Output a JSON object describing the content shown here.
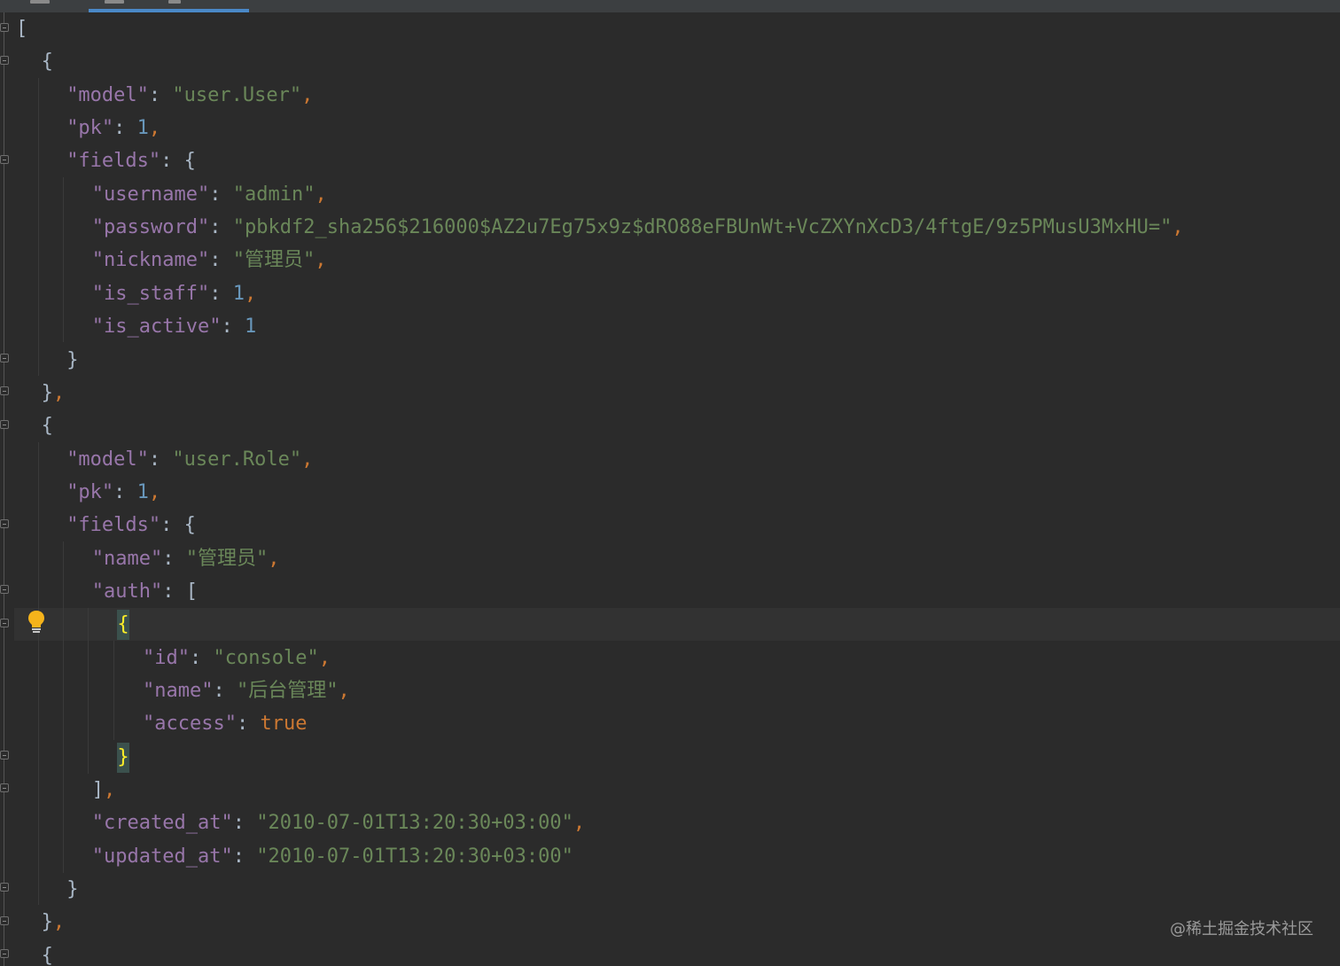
{
  "colors": {
    "background": "#2b2b2b",
    "key": "#9876aa",
    "string": "#6a8759",
    "number": "#6897bb",
    "keyword": "#cc7832",
    "brace_highlight": "#ffef28",
    "tab_indicator": "#4a88c7"
  },
  "icons": {
    "intention": "lightbulb-icon",
    "fold": "fold-marker-icon"
  },
  "watermark": "@稀土掘金技术社区",
  "lines": [
    {
      "indent": 0,
      "tokens": [
        {
          "t": "[",
          "c": "punct"
        }
      ]
    },
    {
      "indent": 1,
      "tokens": [
        {
          "t": "{",
          "c": "punct"
        }
      ]
    },
    {
      "indent": 2,
      "tokens": [
        {
          "t": "\"model\"",
          "c": "key"
        },
        {
          "t": ": ",
          "c": "punct"
        },
        {
          "t": "\"user.User\"",
          "c": "str"
        },
        {
          "t": ",",
          "c": "comma"
        }
      ]
    },
    {
      "indent": 2,
      "tokens": [
        {
          "t": "\"pk\"",
          "c": "key"
        },
        {
          "t": ": ",
          "c": "punct"
        },
        {
          "t": "1",
          "c": "num"
        },
        {
          "t": ",",
          "c": "comma"
        }
      ]
    },
    {
      "indent": 2,
      "tokens": [
        {
          "t": "\"fields\"",
          "c": "key"
        },
        {
          "t": ": ",
          "c": "punct"
        },
        {
          "t": "{",
          "c": "punct"
        }
      ]
    },
    {
      "indent": 3,
      "tokens": [
        {
          "t": "\"username\"",
          "c": "key"
        },
        {
          "t": ": ",
          "c": "punct"
        },
        {
          "t": "\"admin\"",
          "c": "str"
        },
        {
          "t": ",",
          "c": "comma"
        }
      ]
    },
    {
      "indent": 3,
      "tokens": [
        {
          "t": "\"password\"",
          "c": "key"
        },
        {
          "t": ": ",
          "c": "punct"
        },
        {
          "t": "\"pbkdf2_sha256$216000$AZ2u7Eg75x9z$dRO88eFBUnWt+VcZXYnXcD3/4ftgE/9z5PMusU3MxHU=\"",
          "c": "str"
        },
        {
          "t": ",",
          "c": "comma"
        }
      ]
    },
    {
      "indent": 3,
      "tokens": [
        {
          "t": "\"nickname\"",
          "c": "key"
        },
        {
          "t": ": ",
          "c": "punct"
        },
        {
          "t": "\"管理员\"",
          "c": "str"
        },
        {
          "t": ",",
          "c": "comma"
        }
      ]
    },
    {
      "indent": 3,
      "tokens": [
        {
          "t": "\"is_staff\"",
          "c": "key"
        },
        {
          "t": ": ",
          "c": "punct"
        },
        {
          "t": "1",
          "c": "num"
        },
        {
          "t": ",",
          "c": "comma"
        }
      ]
    },
    {
      "indent": 3,
      "tokens": [
        {
          "t": "\"is_active\"",
          "c": "key"
        },
        {
          "t": ": ",
          "c": "punct"
        },
        {
          "t": "1",
          "c": "num"
        }
      ]
    },
    {
      "indent": 2,
      "tokens": [
        {
          "t": "}",
          "c": "punct"
        }
      ]
    },
    {
      "indent": 1,
      "tokens": [
        {
          "t": "}",
          "c": "punct"
        },
        {
          "t": ",",
          "c": "comma"
        }
      ]
    },
    {
      "indent": 1,
      "tokens": [
        {
          "t": "{",
          "c": "punct"
        }
      ]
    },
    {
      "indent": 2,
      "tokens": [
        {
          "t": "\"model\"",
          "c": "key"
        },
        {
          "t": ": ",
          "c": "punct"
        },
        {
          "t": "\"user.Role\"",
          "c": "str"
        },
        {
          "t": ",",
          "c": "comma"
        }
      ]
    },
    {
      "indent": 2,
      "tokens": [
        {
          "t": "\"pk\"",
          "c": "key"
        },
        {
          "t": ": ",
          "c": "punct"
        },
        {
          "t": "1",
          "c": "num"
        },
        {
          "t": ",",
          "c": "comma"
        }
      ]
    },
    {
      "indent": 2,
      "tokens": [
        {
          "t": "\"fields\"",
          "c": "key"
        },
        {
          "t": ": ",
          "c": "punct"
        },
        {
          "t": "{",
          "c": "punct"
        }
      ]
    },
    {
      "indent": 3,
      "tokens": [
        {
          "t": "\"name\"",
          "c": "key"
        },
        {
          "t": ": ",
          "c": "punct"
        },
        {
          "t": "\"管理员\"",
          "c": "str"
        },
        {
          "t": ",",
          "c": "comma"
        }
      ]
    },
    {
      "indent": 3,
      "tokens": [
        {
          "t": "\"auth\"",
          "c": "key"
        },
        {
          "t": ": ",
          "c": "punct"
        },
        {
          "t": "[",
          "c": "punct"
        }
      ]
    },
    {
      "indent": 4,
      "tokens": [
        {
          "t": "{",
          "c": "brace"
        }
      ]
    },
    {
      "indent": 5,
      "tokens": [
        {
          "t": "\"id\"",
          "c": "key"
        },
        {
          "t": ": ",
          "c": "punct"
        },
        {
          "t": "\"console\"",
          "c": "str"
        },
        {
          "t": ",",
          "c": "comma"
        }
      ]
    },
    {
      "indent": 5,
      "tokens": [
        {
          "t": "\"name\"",
          "c": "key"
        },
        {
          "t": ": ",
          "c": "punct"
        },
        {
          "t": "\"后台管理\"",
          "c": "str"
        },
        {
          "t": ",",
          "c": "comma"
        }
      ]
    },
    {
      "indent": 5,
      "tokens": [
        {
          "t": "\"access\"",
          "c": "key"
        },
        {
          "t": ": ",
          "c": "punct"
        },
        {
          "t": "true",
          "c": "kw"
        }
      ]
    },
    {
      "indent": 4,
      "tokens": [
        {
          "t": "}",
          "c": "brace"
        }
      ]
    },
    {
      "indent": 3,
      "tokens": [
        {
          "t": "]",
          "c": "punct"
        },
        {
          "t": ",",
          "c": "comma"
        }
      ]
    },
    {
      "indent": 3,
      "tokens": [
        {
          "t": "\"created_at\"",
          "c": "key"
        },
        {
          "t": ": ",
          "c": "punct"
        },
        {
          "t": "\"2010-07-01T13:20:30+03:00\"",
          "c": "str"
        },
        {
          "t": ",",
          "c": "comma"
        }
      ]
    },
    {
      "indent": 3,
      "tokens": [
        {
          "t": "\"updated_at\"",
          "c": "key"
        },
        {
          "t": ": ",
          "c": "punct"
        },
        {
          "t": "\"2010-07-01T13:20:30+03:00\"",
          "c": "str"
        }
      ]
    },
    {
      "indent": 2,
      "tokens": [
        {
          "t": "}",
          "c": "punct"
        }
      ]
    },
    {
      "indent": 1,
      "tokens": [
        {
          "t": "}",
          "c": "punct"
        },
        {
          "t": ",",
          "c": "comma"
        }
      ]
    },
    {
      "indent": 1,
      "tokens": [
        {
          "t": "{",
          "c": "punct"
        }
      ]
    }
  ]
}
